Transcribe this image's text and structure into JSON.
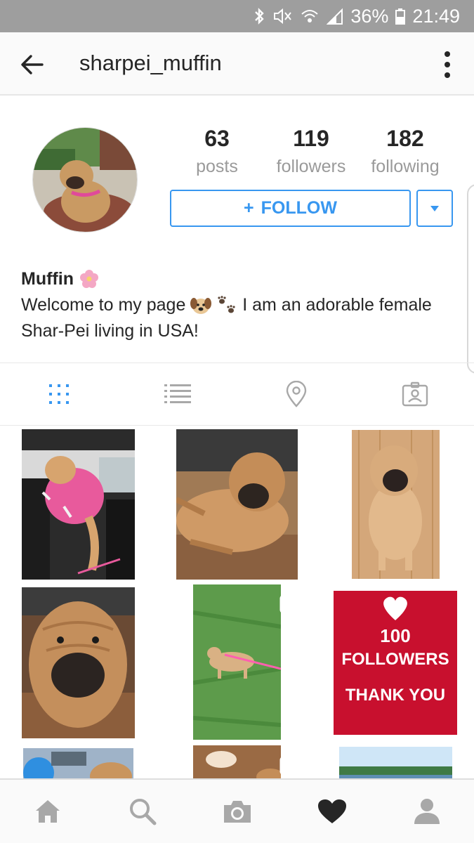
{
  "status_bar": {
    "battery": "36%",
    "time": "21:49",
    "icons": [
      "bluetooth-icon",
      "mute-icon",
      "wifi-icon",
      "signal-icon",
      "battery-icon"
    ]
  },
  "header": {
    "username": "sharpei_muffin",
    "back_icon": "arrow-left-icon",
    "more_icon": "more-vertical-icon"
  },
  "profile": {
    "stats": [
      {
        "value": "63",
        "label": "posts"
      },
      {
        "value": "119",
        "label": "followers"
      },
      {
        "value": "182",
        "label": "following"
      }
    ],
    "follow_label": "FOLLOW",
    "follow_prefix": "+",
    "dropdown_icon": "triangle-down-icon"
  },
  "bio": {
    "name": "Muffin",
    "line1": "Welcome to my page",
    "line1_after": "I am an adorable female",
    "line2": "Shar-Pei living in USA!"
  },
  "tabs": [
    {
      "name": "grid-view",
      "icon": "grid-icon",
      "active": true
    },
    {
      "name": "list-view",
      "icon": "list-icon",
      "active": false
    },
    {
      "name": "map-view",
      "icon": "location-pin-icon",
      "active": false
    },
    {
      "name": "tagged-view",
      "icon": "tagged-portrait-icon",
      "active": false
    }
  ],
  "posts": [
    {
      "subject": "dog in pink vest in car",
      "video": false
    },
    {
      "subject": "dog lying on floor",
      "video": false
    },
    {
      "subject": "dog sitting on wood floor",
      "video": false
    },
    {
      "subject": "dog face close-up",
      "video": false
    },
    {
      "subject": "dog on grass with pink leash",
      "video": true
    },
    {
      "subject": "followers milestone graphic",
      "video": false,
      "text_lines": [
        "100",
        "FOLLOWERS",
        "THANK YOU"
      ]
    },
    {
      "subject": "dog outdoors",
      "video": false
    },
    {
      "subject": "dog indoors",
      "video": true
    },
    {
      "subject": "lake landscape",
      "video": false
    }
  ],
  "bottom_nav": [
    {
      "name": "home",
      "icon": "home-icon"
    },
    {
      "name": "search",
      "icon": "search-icon"
    },
    {
      "name": "camera",
      "icon": "camera-icon"
    },
    {
      "name": "activity",
      "icon": "heart-icon"
    },
    {
      "name": "profile",
      "icon": "profile-icon"
    }
  ],
  "colors": {
    "accent": "#3897f0",
    "status_bar": "#9e9e9e",
    "milestone_red": "#c8102e",
    "text": "#262626",
    "muted": "#9a9a9a"
  }
}
